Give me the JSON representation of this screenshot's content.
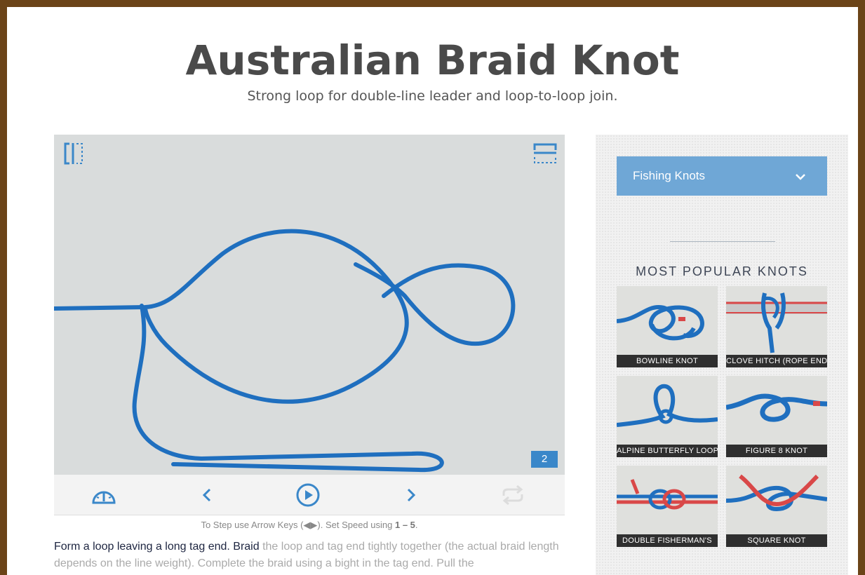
{
  "header": {
    "title": "Australian Braid Knot",
    "subtitle": "Strong loop for double-line leader and loop-to-loop join."
  },
  "player": {
    "step": "2",
    "toolbar_icons": [
      "split-view-icon",
      "fullscreen-icon"
    ],
    "control_icons": [
      "speed-gauge-icon",
      "chevron-left-icon",
      "play-icon",
      "chevron-right-icon",
      "repeat-icon"
    ],
    "hint": {
      "part1": "To Step use Arrow Keys (",
      "part2": "). Set Speed using ",
      "keys": "1 – 5",
      "end": "."
    },
    "colors": {
      "rope": "#1f6fbf",
      "background": "#d9dcdc",
      "accent": "#3a87c9"
    }
  },
  "description": {
    "highlight": "Form a loop leaving a long tag end. Braid",
    "rest": " the loop and tag end tightly together (the actual braid length depends on the line weight). Complete the braid using a bight in the tag end. Pull the"
  },
  "sidebar": {
    "category_select": "Fishing Knots",
    "popular_heading": "MOST POPULAR KNOTS",
    "knots": [
      {
        "label": "BOWLINE KNOT"
      },
      {
        "label": "CLOVE HITCH (ROPE END)"
      },
      {
        "label": "ALPINE BUTTERFLY LOOP"
      },
      {
        "label": "FIGURE 8 KNOT"
      },
      {
        "label": "DOUBLE FISHERMAN'S"
      },
      {
        "label": "SQUARE KNOT"
      }
    ],
    "colors": {
      "dropdown": "#6fa7d6",
      "caption_bg": "#2f2f2f"
    }
  }
}
